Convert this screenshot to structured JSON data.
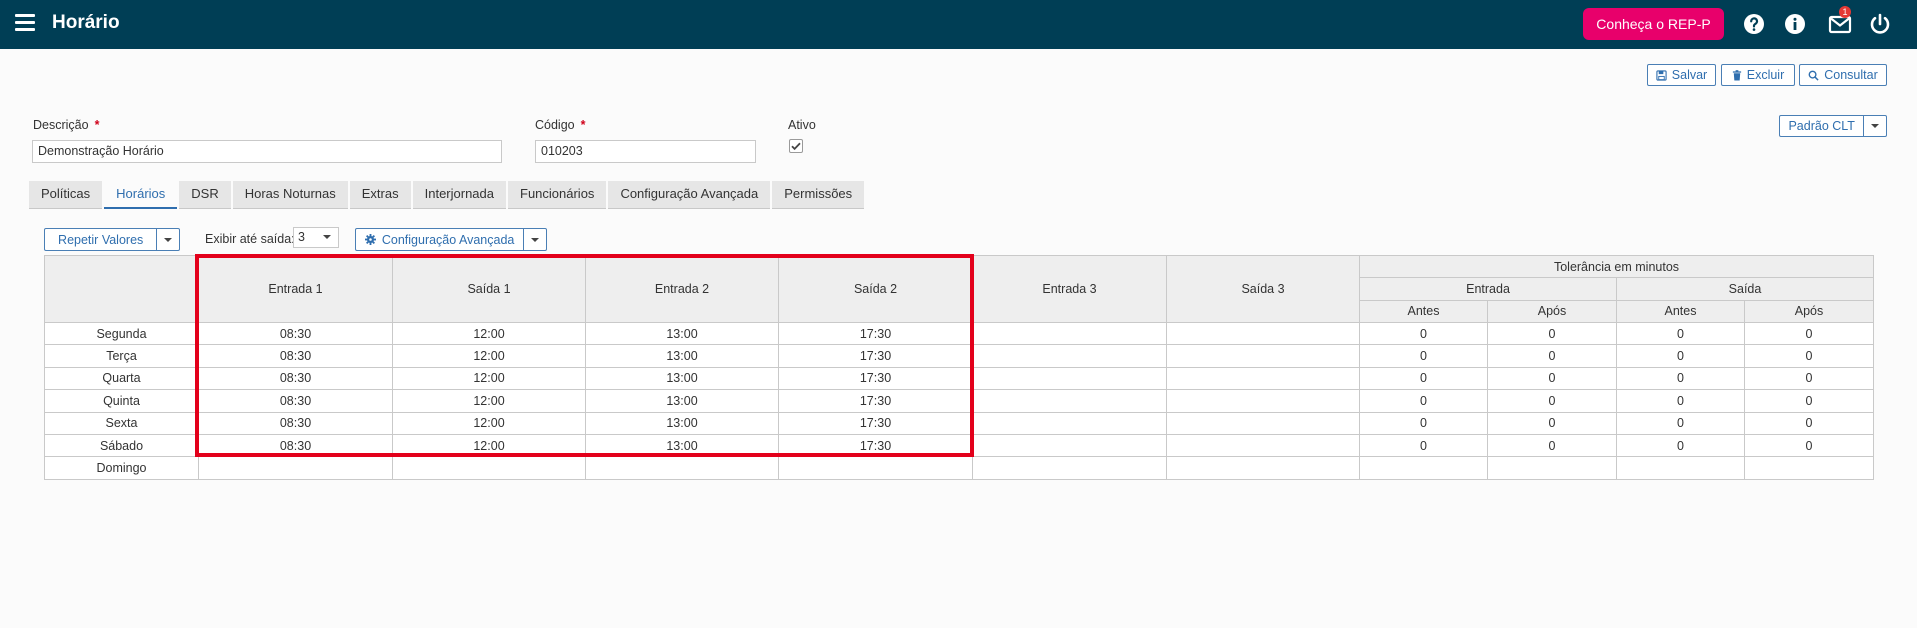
{
  "header": {
    "title": "Horário",
    "cta_label": "Conheça o REP-P",
    "notification_count": "1",
    "icons": [
      "menu-icon",
      "help-icon",
      "info-icon",
      "mail-icon",
      "power-icon"
    ]
  },
  "toolbar": {
    "save_label": "Salvar",
    "delete_label": "Excluir",
    "search_label": "Consultar"
  },
  "form": {
    "description_label": "Descrição",
    "description_value": "Demonstração Horário",
    "code_label": "Código",
    "code_value": "010203",
    "required_mark": "*",
    "active_label": "Ativo",
    "active_checked": true,
    "template_label": "Padrão CLT"
  },
  "tabs": [
    {
      "label": "Políticas",
      "active": false
    },
    {
      "label": "Horários",
      "active": true
    },
    {
      "label": "DSR",
      "active": false
    },
    {
      "label": "Horas Noturnas",
      "active": false
    },
    {
      "label": "Extras",
      "active": false
    },
    {
      "label": "Interjornada",
      "active": false
    },
    {
      "label": "Funcionários",
      "active": false
    },
    {
      "label": "Configuração Avançada",
      "active": false
    },
    {
      "label": "Permissões",
      "active": false
    }
  ],
  "schedule_toolbar": {
    "repeat_label": "Repetir Valores",
    "show_until_label": "Exibir até saída:",
    "show_until_value": "3",
    "advanced_label": "Configuração Avançada"
  },
  "table": {
    "columns": [
      "Entrada 1",
      "Saída 1",
      "Entrada 2",
      "Saída 2",
      "Entrada 3",
      "Saída 3"
    ],
    "tolerance_header": "Tolerância em minutos",
    "tolerance_groups": [
      "Entrada",
      "Saída"
    ],
    "tolerance_subcols": [
      "Antes",
      "Após",
      "Antes",
      "Após"
    ],
    "rows": [
      {
        "day": "Segunda",
        "cells": [
          "08:30",
          "12:00",
          "13:00",
          "17:30",
          "",
          "",
          "0",
          "0",
          "0",
          "0"
        ]
      },
      {
        "day": "Terça",
        "cells": [
          "08:30",
          "12:00",
          "13:00",
          "17:30",
          "",
          "",
          "0",
          "0",
          "0",
          "0"
        ]
      },
      {
        "day": "Quarta",
        "cells": [
          "08:30",
          "12:00",
          "13:00",
          "17:30",
          "",
          "",
          "0",
          "0",
          "0",
          "0"
        ]
      },
      {
        "day": "Quinta",
        "cells": [
          "08:30",
          "12:00",
          "13:00",
          "17:30",
          "",
          "",
          "0",
          "0",
          "0",
          "0"
        ]
      },
      {
        "day": "Sexta",
        "cells": [
          "08:30",
          "12:00",
          "13:00",
          "17:30",
          "",
          "",
          "0",
          "0",
          "0",
          "0"
        ]
      },
      {
        "day": "Sábado",
        "cells": [
          "08:30",
          "12:00",
          "13:00",
          "17:30",
          "",
          "",
          "0",
          "0",
          "0",
          "0"
        ]
      },
      {
        "day": "Domingo",
        "cells": [
          "",
          "",
          "",
          "",
          "",
          "",
          "",
          "",
          "",
          ""
        ]
      }
    ]
  },
  "colors": {
    "topbar": "#003e55",
    "cta": "#e8006b",
    "accent": "#2f6eae",
    "highlight": "#e3001b"
  }
}
